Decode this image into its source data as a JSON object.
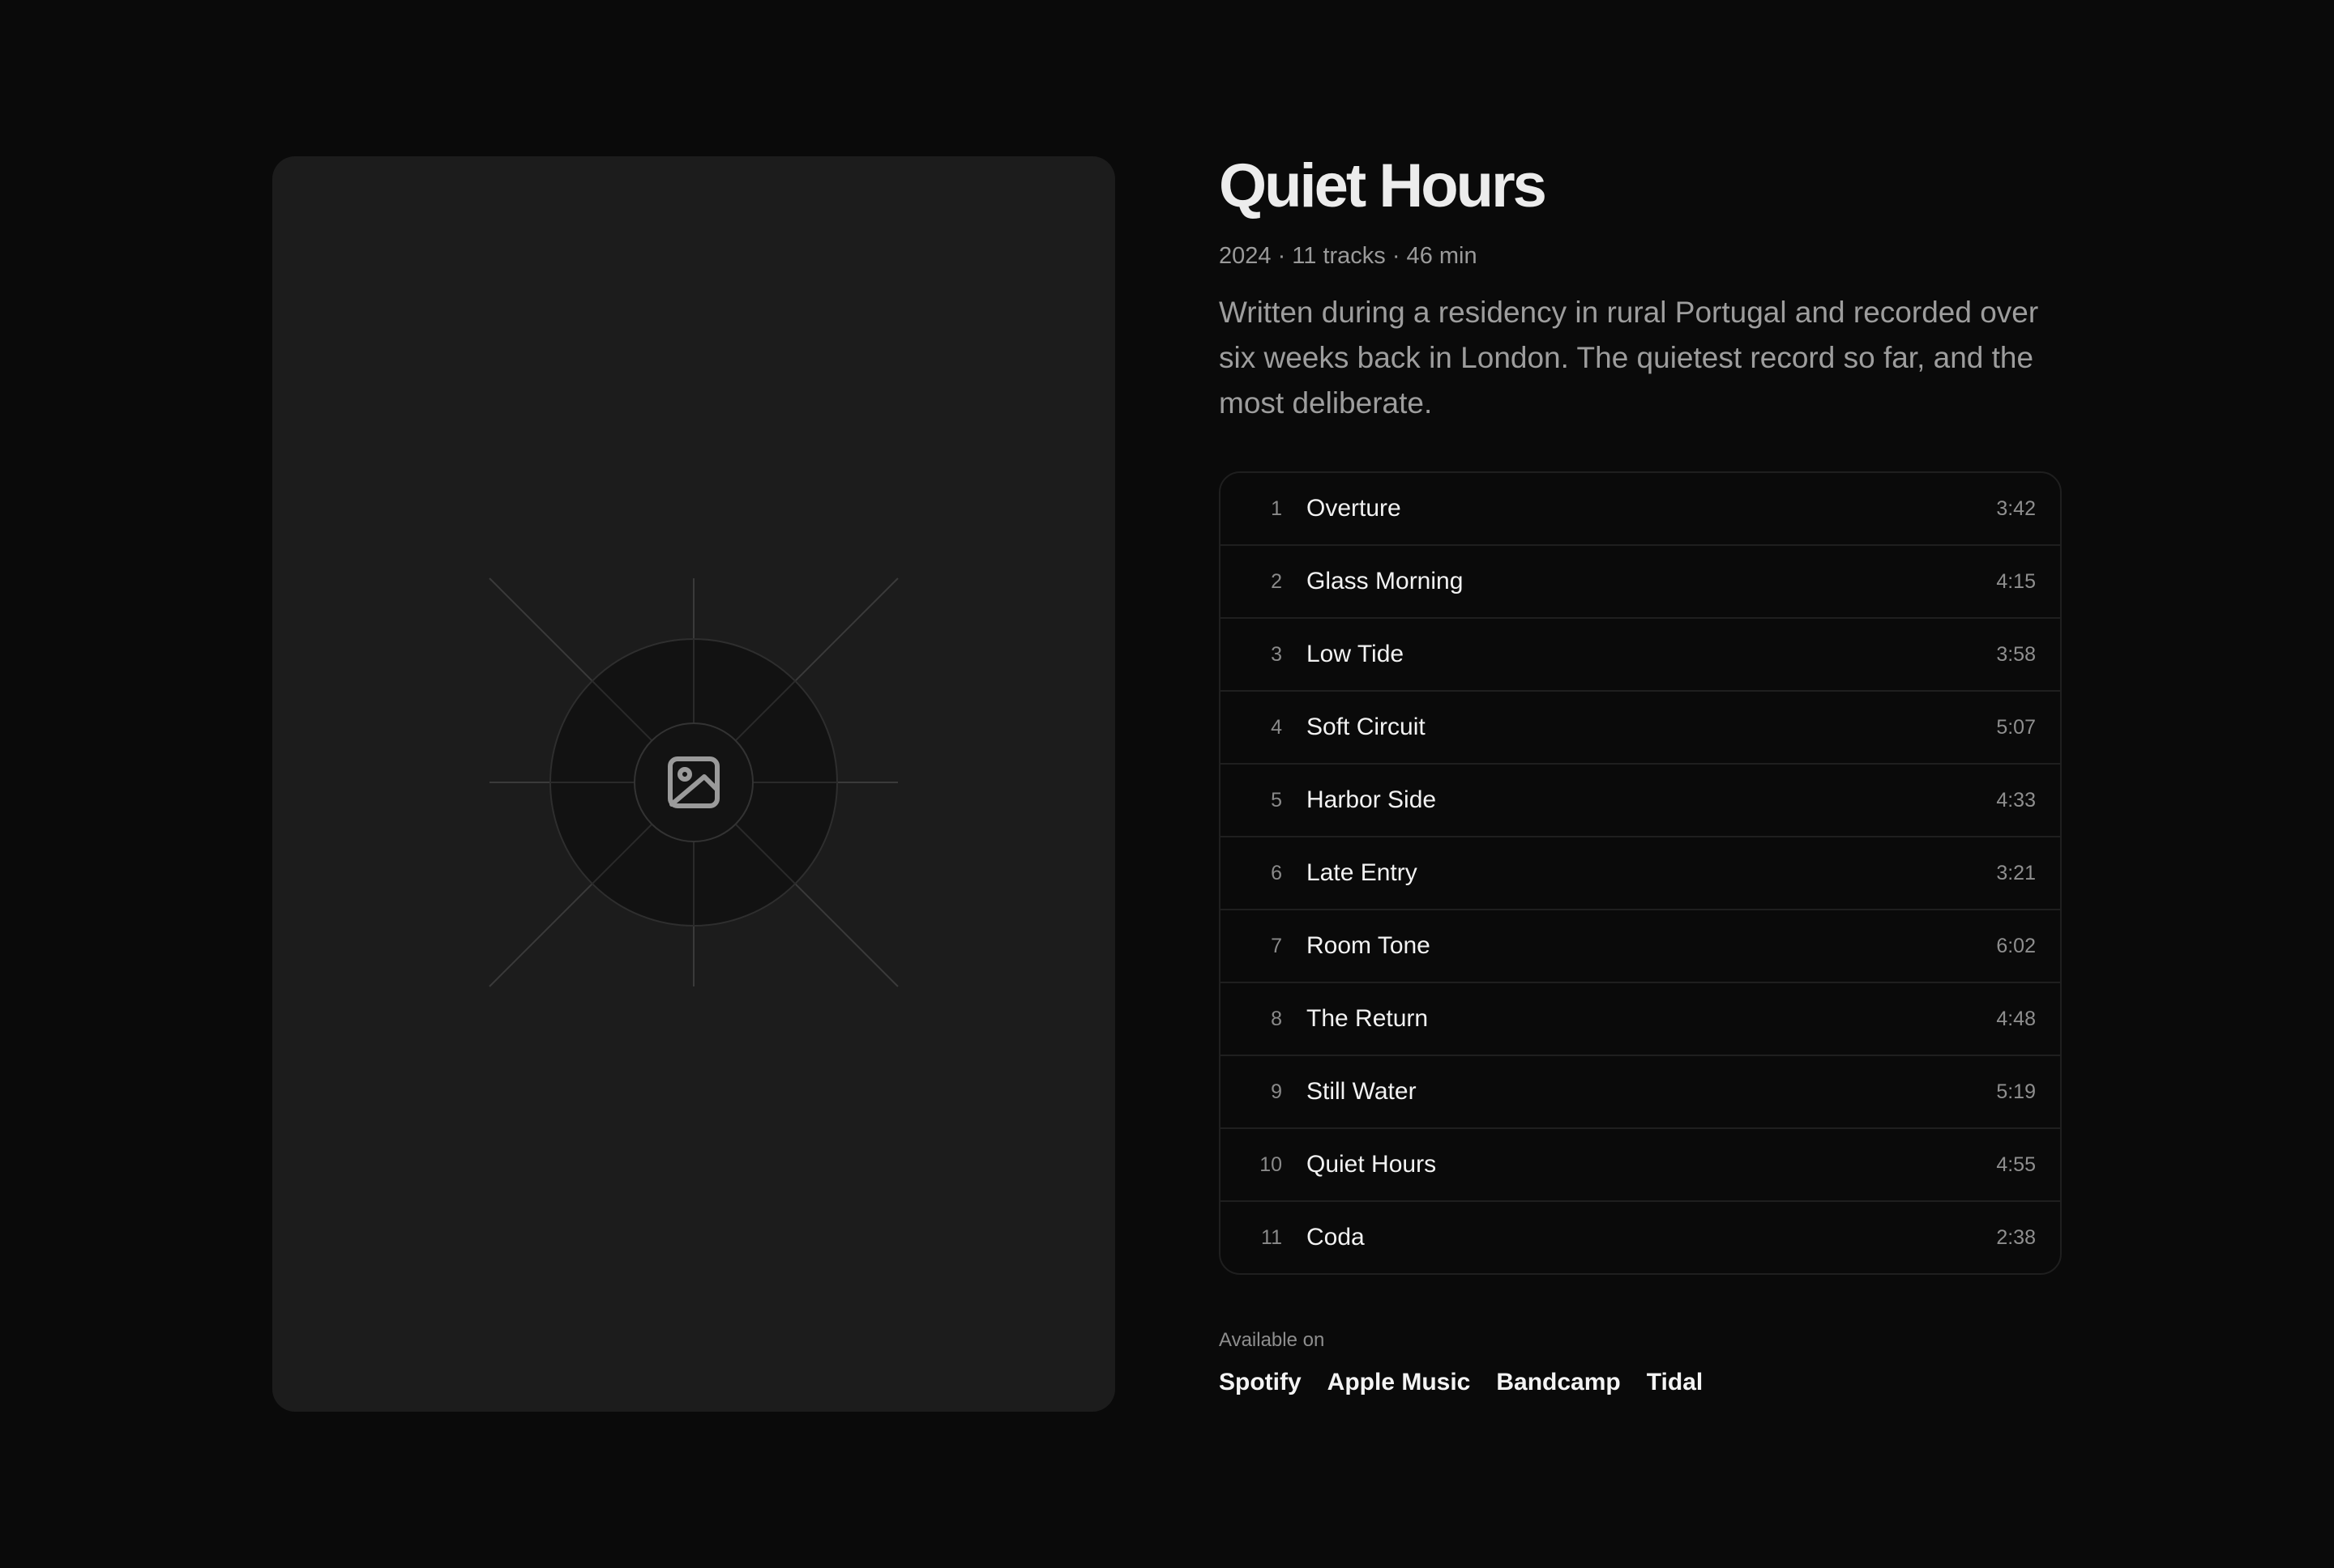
{
  "album": {
    "title": "Quiet Hours",
    "meta": "2024 · 11 tracks · 46 min",
    "description": "Written during a residency in rural Portugal and recorded over six weeks back in London. The quietest record so far, and the most deliberate.",
    "cover_icon": "image-icon"
  },
  "tracks": [
    {
      "number": "1",
      "title": "Overture",
      "duration": "3:42"
    },
    {
      "number": "2",
      "title": "Glass Morning",
      "duration": "4:15"
    },
    {
      "number": "3",
      "title": "Low Tide",
      "duration": "3:58"
    },
    {
      "number": "4",
      "title": "Soft Circuit",
      "duration": "5:07"
    },
    {
      "number": "5",
      "title": "Harbor Side",
      "duration": "4:33"
    },
    {
      "number": "6",
      "title": "Late Entry",
      "duration": "3:21"
    },
    {
      "number": "7",
      "title": "Room Tone",
      "duration": "6:02"
    },
    {
      "number": "8",
      "title": "The Return",
      "duration": "4:48"
    },
    {
      "number": "9",
      "title": "Still Water",
      "duration": "5:19"
    },
    {
      "number": "10",
      "title": "Quiet Hours",
      "duration": "4:55"
    },
    {
      "number": "11",
      "title": "Coda",
      "duration": "2:38"
    }
  ],
  "available": {
    "label": "Available on",
    "platforms": [
      "Spotify",
      "Apple Music",
      "Bandcamp",
      "Tidal"
    ]
  }
}
